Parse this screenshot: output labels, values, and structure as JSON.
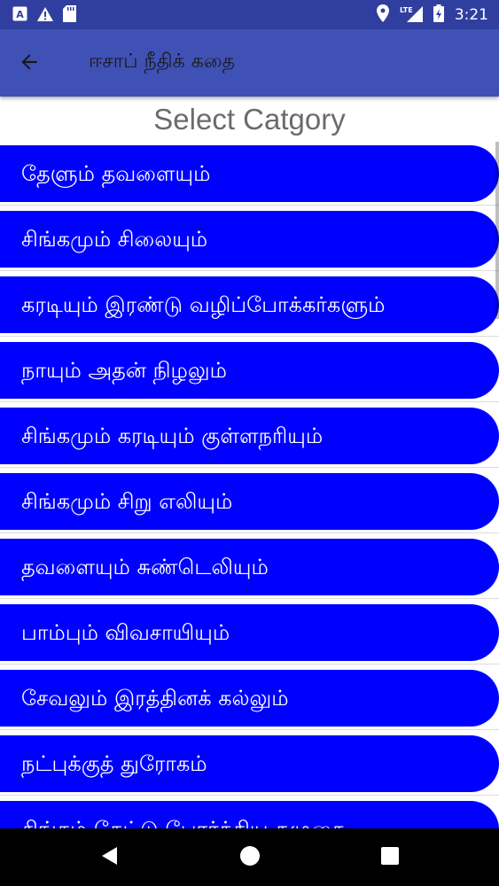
{
  "status_bar": {
    "time": "3:21",
    "network": "LTE",
    "icons_left": [
      "a-icon",
      "alert-icon",
      "sd-card-icon"
    ],
    "icons_right": [
      "location-icon",
      "signal-icon",
      "battery-charging-icon"
    ]
  },
  "app_bar": {
    "title": "ஈசாப் நீதிக் கதை",
    "back_icon": "arrow-back-icon"
  },
  "heading": "Select Catgory",
  "categories": [
    "தேளும் தவளையும்",
    "சிங்கமும் சிலையும்",
    "கரடியும் இரண்டு வழிப்போக்கர்களும்",
    "நாயும் அதன் நிழலும்",
    "சிங்கமும் கரடியும் குள்ளநரியும்",
    "சிங்கமும் சிறு எலியும்",
    "தவளையும் சுண்டெலியும்",
    "பாம்பும் விவசாயியும்",
    "சேவலும் இரத்தினக் கல்லும்",
    "நட்புக்குத் துரோகம்",
    "சிங்கம் கேட்டு போர்த்திய கழுதை"
  ],
  "colors": {
    "status_bar": "#303F9F",
    "app_bar": "#3F51B5",
    "pill": "#0000FF",
    "heading_text": "#6b6b6b"
  },
  "nav_bar": {
    "buttons": [
      "back-triangle-icon",
      "home-circle-icon",
      "recents-square-icon"
    ]
  }
}
